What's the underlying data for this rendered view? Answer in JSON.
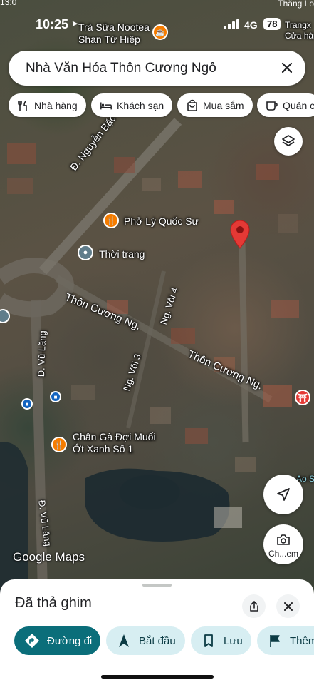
{
  "status_bar": {
    "time": "10:25",
    "network": "4G",
    "battery": "78",
    "top_left_partial": "13:0",
    "top_right_partial": "Thăng Lo"
  },
  "map": {
    "labels": {
      "tra_sua": "Trà Sữa Nootea\nShan Tứ Hiệp",
      "trangx": "Trangx\nCửa hàng",
      "nguyen_bac": "Đ. Nguyễn Bặc",
      "pho": "Phở Lý Quốc Sư",
      "thoi_trang": "Thời trang",
      "thon_cuong_1": "Thôn Cương Ng.",
      "ngo_voi_4": "Ng. Vôi 4",
      "thon_cuong_2": "Thôn Cương Ng.",
      "ngo_voi_3": "Ng. Vôi 3",
      "vu_lang_1": "Đ. Vũ Lăng",
      "vu_lang_2": "Đ. Vũ Lăng",
      "chan_ga": "Chân Gà Đợi Muối\nỚt Xanh Số 1",
      "ao": "Ao S"
    },
    "google_logo": "Google Maps",
    "camera_label": "Ch...em",
    "accent_pin": "#e53935",
    "poi_orange": "#f57c00"
  },
  "search": {
    "query": "Nhà Văn Hóa Thôn Cương Ngô"
  },
  "chips": [
    {
      "label": "Nhà hàng",
      "icon": "fork-knife-icon"
    },
    {
      "label": "Khách sạn",
      "icon": "bed-icon"
    },
    {
      "label": "Mua sắm",
      "icon": "shopping-bag-icon"
    },
    {
      "label": "Quán cà",
      "icon": "coffee-cup-icon"
    }
  ],
  "sheet": {
    "title": "Đã thả ghim",
    "actions": [
      {
        "label": "Đường đi",
        "icon": "directions-icon"
      },
      {
        "label": "Bắt đầu",
        "icon": "navigation-arrow-icon"
      },
      {
        "label": "Lưu",
        "icon": "bookmark-icon"
      },
      {
        "label": "Thêm",
        "icon": "flag-icon"
      }
    ],
    "primary_color": "#0b6e7a",
    "secondary_bg": "#d7eef2"
  }
}
